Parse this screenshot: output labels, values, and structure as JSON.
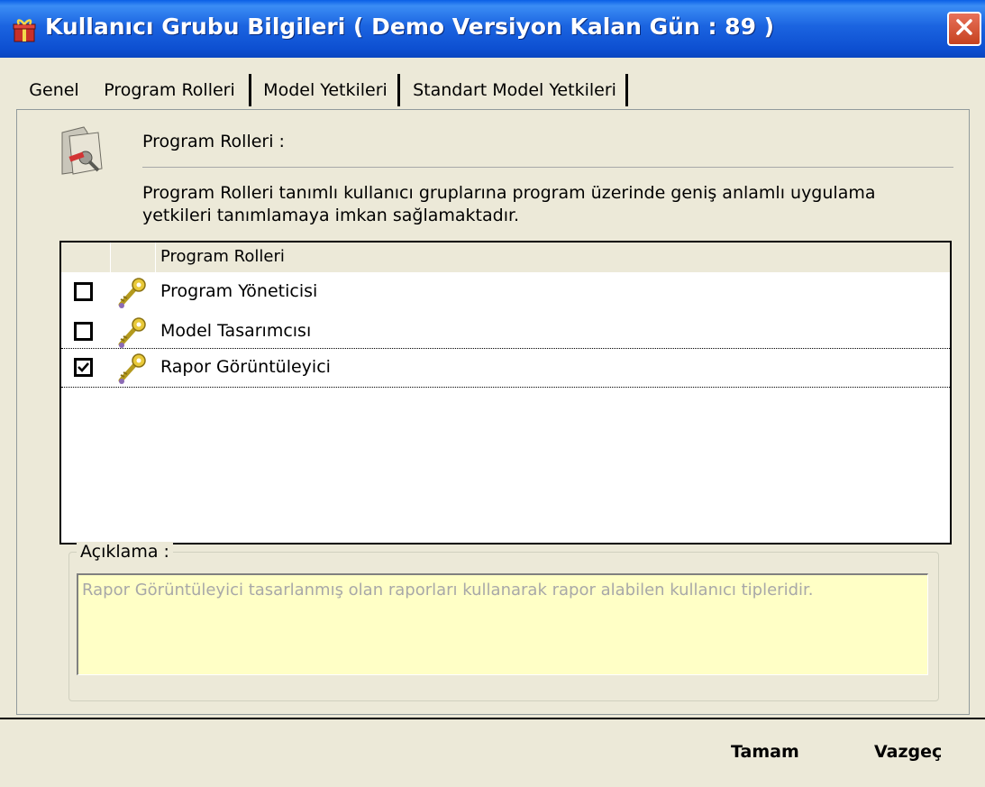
{
  "window": {
    "title": "Kullanıcı Grubu Bilgileri ( Demo Versiyon  Kalan Gün : 89 )",
    "close_icon": "close-icon",
    "app_icon": "app-gift-icon"
  },
  "tabs": [
    {
      "label": "Genel",
      "active": false
    },
    {
      "label": "Program Rolleri",
      "active": true
    },
    {
      "label": "Model Yetkileri",
      "active": false
    },
    {
      "label": "Standart Model Yetkileri",
      "active": false
    }
  ],
  "header": {
    "icon": "settings-folder-icon",
    "title": "Program Rolleri :",
    "description": "Program Rolleri tanımlı kullanıcı gruplarına program üzerinde geniş anlamlı uygulama yetkileri tanımlamaya imkan sağlamaktadır."
  },
  "roles": {
    "column_header": "Program Rolleri",
    "items": [
      {
        "label": "Program Yöneticisi",
        "checked": false,
        "icon": "key-icon"
      },
      {
        "label": "Model Tasarımcısı",
        "checked": false,
        "icon": "key-icon"
      },
      {
        "label": "Rapor Görüntüleyici",
        "checked": true,
        "icon": "key-icon"
      }
    ]
  },
  "description_group": {
    "legend": "Açıklama :",
    "text": "Rapor Görüntüleyici tasarlanmış olan raporları kullanarak rapor alabilen kullanıcı tipleridir."
  },
  "buttons": {
    "ok": "Tamam",
    "cancel": "Vazgeç"
  },
  "colors": {
    "titlebar": "#0D4FD1",
    "window_bg": "#ECE9D8",
    "description_bg": "#FFFFC6",
    "close_button": "#C6421F"
  }
}
